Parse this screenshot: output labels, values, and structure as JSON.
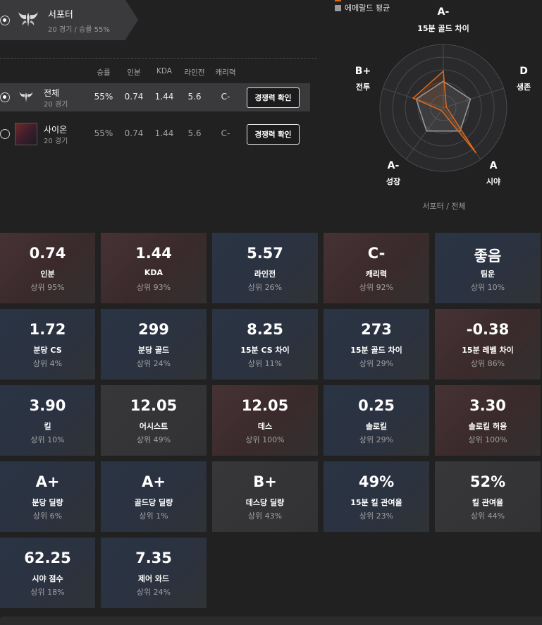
{
  "role": {
    "name": "서포터",
    "subtitle": "20 경기 / 승률 55%"
  },
  "table": {
    "headers": [
      "승률",
      "인분",
      "KDA",
      "라인전",
      "캐리력"
    ],
    "rows": [
      {
        "name": "전체",
        "games": "20 경기",
        "winrate": "55%",
        "inbun": "0.74",
        "kda": "1.44",
        "lane": "5.6",
        "carry": "C-",
        "button": "경쟁력 확인",
        "selected": true
      },
      {
        "name": "사이온",
        "games": "20 경기",
        "winrate": "55%",
        "inbun": "0.74",
        "kda": "1.44",
        "lane": "5.6",
        "carry": "C-",
        "button": "경쟁력 확인",
        "selected": false
      }
    ]
  },
  "radar": {
    "legend": "에메랄드 평균",
    "caption": "서포터 / 전체",
    "colors": {
      "player": "#e0691b",
      "average": "#9a9a9a"
    },
    "axes": [
      {
        "grade": "A-",
        "name": "15분 골드 차이",
        "player": 0.58,
        "average": 0.42
      },
      {
        "grade": "D",
        "name": "생존",
        "player": 0.05,
        "average": 0.45
      },
      {
        "grade": "A",
        "name": "시야",
        "player": 0.88,
        "average": 0.45
      },
      {
        "grade": "A-",
        "name": "성장",
        "player": 0.05,
        "average": 0.45
      },
      {
        "grade": "B+",
        "name": "전투",
        "player": 0.5,
        "average": 0.45
      }
    ]
  },
  "stats": [
    {
      "value": "0.74",
      "name": "인분",
      "rank": "상위 95%",
      "tone": "red"
    },
    {
      "value": "1.44",
      "name": "KDA",
      "rank": "상위 93%",
      "tone": "red"
    },
    {
      "value": "5.57",
      "name": "라인전",
      "rank": "상위 26%",
      "tone": "blue"
    },
    {
      "value": "C-",
      "name": "캐리력",
      "rank": "상위 92%",
      "tone": "red"
    },
    {
      "value": "좋음",
      "name": "팀운",
      "rank": "상위 10%",
      "tone": "blue"
    },
    {
      "value": "1.72",
      "name": "분당 CS",
      "rank": "상위 4%",
      "tone": "blue"
    },
    {
      "value": "299",
      "name": "분당 골드",
      "rank": "상위 24%",
      "tone": "blue"
    },
    {
      "value": "8.25",
      "name": "15분 CS 차이",
      "rank": "상위 11%",
      "tone": "blue"
    },
    {
      "value": "273",
      "name": "15분 골드 차이",
      "rank": "상위 29%",
      "tone": "blue"
    },
    {
      "value": "-0.38",
      "name": "15분 레벨 차이",
      "rank": "상위 86%",
      "tone": "red"
    },
    {
      "value": "3.90",
      "name": "킬",
      "rank": "상위 10%",
      "tone": "blue"
    },
    {
      "value": "12.05",
      "name": "어시스트",
      "rank": "상위 49%",
      "tone": "grey"
    },
    {
      "value": "12.05",
      "name": "데스",
      "rank": "상위 100%",
      "tone": "red"
    },
    {
      "value": "0.25",
      "name": "솔로킬",
      "rank": "상위 29%",
      "tone": "blue"
    },
    {
      "value": "3.30",
      "name": "솔로킬 허용",
      "rank": "상위 100%",
      "tone": "red"
    },
    {
      "value": "A+",
      "name": "분당 딜량",
      "rank": "상위 6%",
      "tone": "blue"
    },
    {
      "value": "A+",
      "name": "골드당 딜량",
      "rank": "상위 1%",
      "tone": "blue"
    },
    {
      "value": "B+",
      "name": "데스당 딜량",
      "rank": "상위 43%",
      "tone": "grey"
    },
    {
      "value": "49%",
      "name": "15분 킬 관여율",
      "rank": "상위 23%",
      "tone": "blue"
    },
    {
      "value": "52%",
      "name": "킬 관여율",
      "rank": "상위 44%",
      "tone": "grey"
    },
    {
      "value": "62.25",
      "name": "시야 점수",
      "rank": "상위 18%",
      "tone": "blue"
    },
    {
      "value": "7.35",
      "name": "제어 와드",
      "rank": "상위 24%",
      "tone": "blue"
    }
  ]
}
